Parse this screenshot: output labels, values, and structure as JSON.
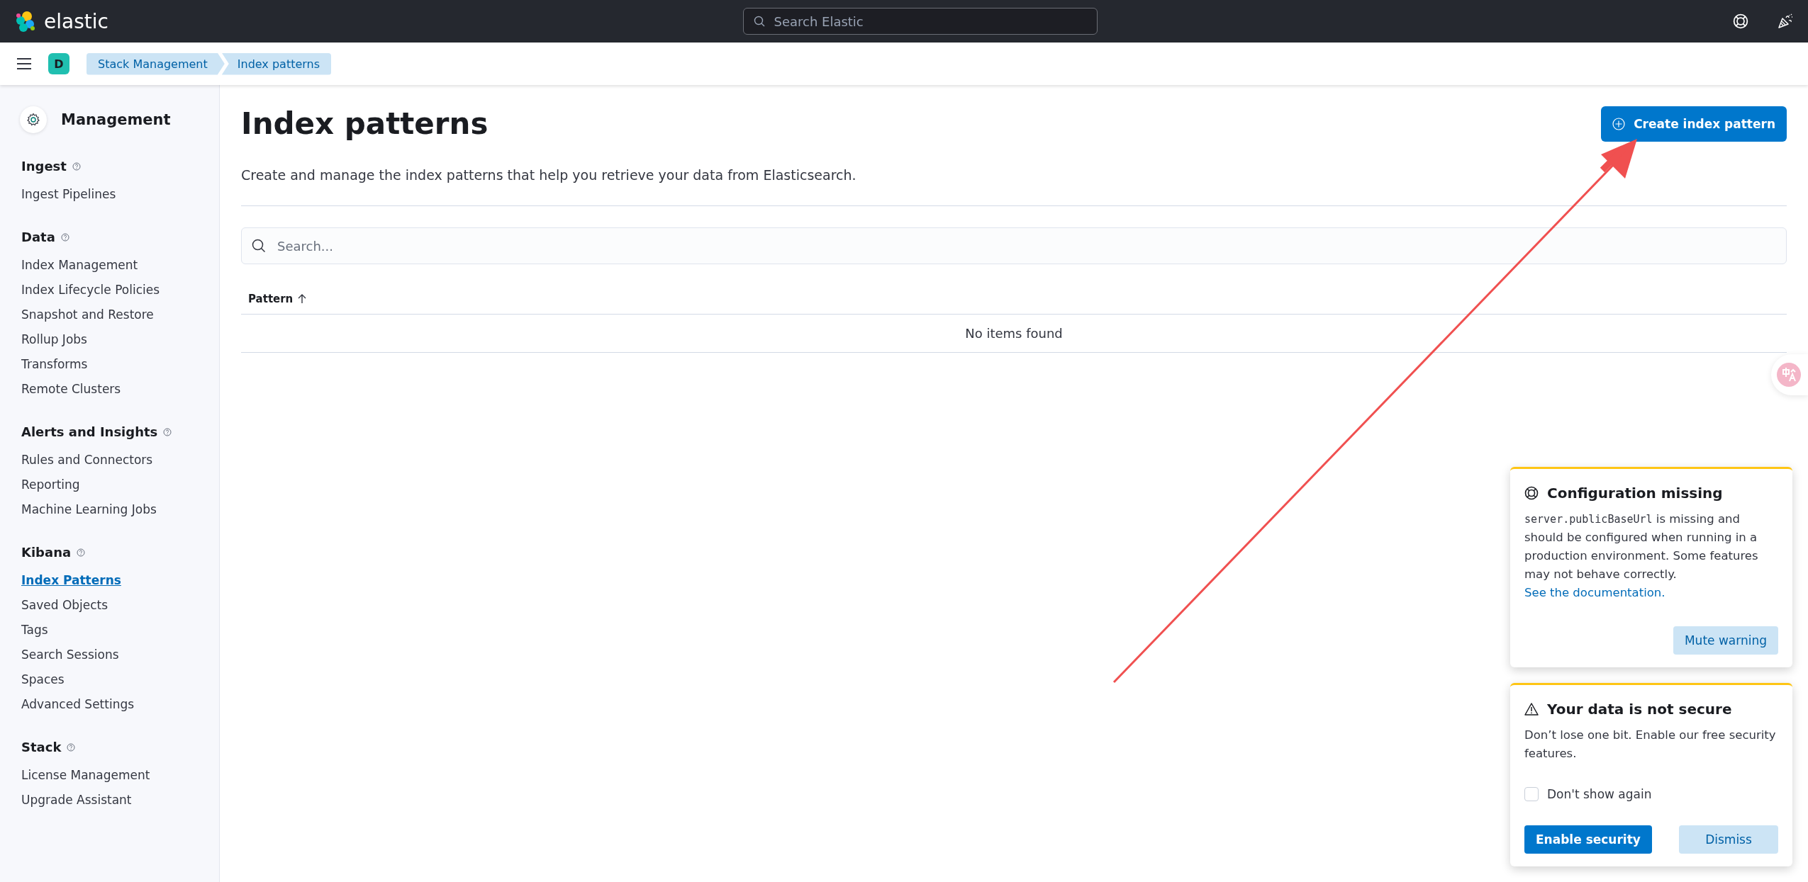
{
  "header": {
    "logo_text": "elastic",
    "search": {
      "placeholder": "Search Elastic"
    }
  },
  "subheader": {
    "space_badge": "D",
    "breadcrumbs": [
      "Stack Management",
      "Index patterns"
    ]
  },
  "sidebar": {
    "title": "Management",
    "sections": [
      {
        "title": "Ingest",
        "items": [
          {
            "label": "Ingest Pipelines",
            "selected": false
          }
        ]
      },
      {
        "title": "Data",
        "items": [
          {
            "label": "Index Management",
            "selected": false
          },
          {
            "label": "Index Lifecycle Policies",
            "selected": false
          },
          {
            "label": "Snapshot and Restore",
            "selected": false
          },
          {
            "label": "Rollup Jobs",
            "selected": false
          },
          {
            "label": "Transforms",
            "selected": false
          },
          {
            "label": "Remote Clusters",
            "selected": false
          }
        ]
      },
      {
        "title": "Alerts and Insights",
        "items": [
          {
            "label": "Rules and Connectors",
            "selected": false
          },
          {
            "label": "Reporting",
            "selected": false
          },
          {
            "label": "Machine Learning Jobs",
            "selected": false
          }
        ]
      },
      {
        "title": "Kibana",
        "items": [
          {
            "label": "Index Patterns",
            "selected": true
          },
          {
            "label": "Saved Objects",
            "selected": false
          },
          {
            "label": "Tags",
            "selected": false
          },
          {
            "label": "Search Sessions",
            "selected": false
          },
          {
            "label": "Spaces",
            "selected": false
          },
          {
            "label": "Advanced Settings",
            "selected": false
          }
        ]
      },
      {
        "title": "Stack",
        "items": [
          {
            "label": "License Management",
            "selected": false
          },
          {
            "label": "Upgrade Assistant",
            "selected": false
          }
        ]
      }
    ]
  },
  "page": {
    "title": "Index patterns",
    "create_button": "Create index pattern",
    "description": "Create and manage the index patterns that help you retrieve your data from Elasticsearch.",
    "search": {
      "placeholder": "Search..."
    },
    "table": {
      "columns": [
        "Pattern"
      ],
      "empty_message": "No items found"
    }
  },
  "toasts": [
    {
      "kind": "config",
      "title": "Configuration missing",
      "code": "server.publicBaseUrl",
      "text": " is missing and should be configured when running in a production environment. Some features may not behave correctly. ",
      "link": "See the documentation.",
      "buttons": [
        "Mute warning"
      ]
    },
    {
      "kind": "security",
      "title": "Your data is not secure",
      "text": "Don’t lose one bit. Enable our free security features.",
      "checkbox": {
        "label": "Don't show again",
        "checked": false
      },
      "buttons": [
        "Enable security",
        "Dismiss"
      ]
    }
  ]
}
